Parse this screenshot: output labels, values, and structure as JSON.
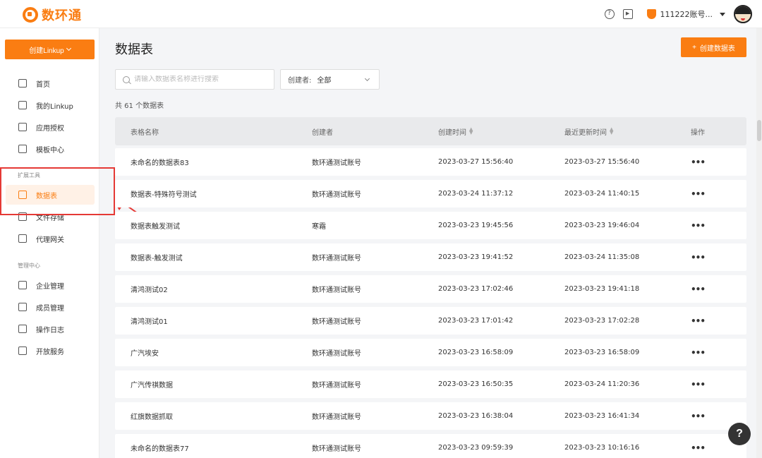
{
  "brand": {
    "name": "数环通",
    "color": "#fa7d12"
  },
  "header": {
    "help_icon": "question-circle-icon",
    "video_icon": "play-square-icon",
    "account_name": "111222账号...",
    "account_icon": "shield-icon"
  },
  "sidebar": {
    "create_button_label": "创建Linkup",
    "items_main": [
      {
        "label": "首页",
        "icon": "home-icon"
      },
      {
        "label": "我的Linkup",
        "icon": "layers-icon"
      },
      {
        "label": "应用授权",
        "icon": "cube-icon"
      },
      {
        "label": "模板中心",
        "icon": "grid-icon"
      }
    ],
    "section_tools": "扩展工具",
    "items_tools": [
      {
        "label": "数据表",
        "icon": "table-icon",
        "active": true
      },
      {
        "label": "文件存储",
        "icon": "folder-icon"
      },
      {
        "label": "代理网关",
        "icon": "gateway-icon"
      }
    ],
    "section_admin": "管理中心",
    "items_admin": [
      {
        "label": "企业管理",
        "icon": "building-icon"
      },
      {
        "label": "成员管理",
        "icon": "users-icon"
      },
      {
        "label": "操作日志",
        "icon": "clipboard-icon"
      },
      {
        "label": "开放服务",
        "icon": "share-icon"
      }
    ]
  },
  "main": {
    "title": "数据表",
    "create_button_label": "创建数据表",
    "search_placeholder": "请输入数据表名称进行搜索",
    "filter_label": "创建者:",
    "filter_value": "全部",
    "count_text": "共 61 个数据表",
    "columns": {
      "name": "表格名称",
      "creator": "创建者",
      "created": "创建时间",
      "updated": "最近更新时间",
      "actions": "操作"
    },
    "rows": [
      {
        "name": "未命名的数据表83",
        "creator": "数环通测试账号",
        "created": "2023-03-27 15:56:40",
        "updated": "2023-03-27 15:56:40",
        "actions": "•••"
      },
      {
        "name": "数据表-特殊符号测试",
        "creator": "数环通测试账号",
        "created": "2023-03-24 11:37:12",
        "updated": "2023-03-24 11:40:15",
        "actions": "•••"
      },
      {
        "name": "数据表触发测试",
        "creator": "寒霜",
        "created": "2023-03-23 19:45:56",
        "updated": "2023-03-23 19:46:04",
        "actions": "•••"
      },
      {
        "name": "数据表-触发测试",
        "creator": "数环通测试账号",
        "created": "2023-03-23 19:41:52",
        "updated": "2023-03-24 11:35:08",
        "actions": "•••"
      },
      {
        "name": "清鸿测试02",
        "creator": "数环通测试账号",
        "created": "2023-03-23 17:02:46",
        "updated": "2023-03-23 19:41:18",
        "actions": "•••"
      },
      {
        "name": "清鸿测试01",
        "creator": "数环通测试账号",
        "created": "2023-03-23 17:01:42",
        "updated": "2023-03-23 17:02:28",
        "actions": "•••"
      },
      {
        "name": "广汽埃安",
        "creator": "数环通测试账号",
        "created": "2023-03-23 16:58:09",
        "updated": "2023-03-23 16:58:09",
        "actions": "•••"
      },
      {
        "name": "广汽传祺数据",
        "creator": "数环通测试账号",
        "created": "2023-03-23 16:50:35",
        "updated": "2023-03-24 11:20:36",
        "actions": "•••"
      },
      {
        "name": "红旗数据抓取",
        "creator": "数环通测试账号",
        "created": "2023-03-23 16:38:04",
        "updated": "2023-03-23 16:41:34",
        "actions": "•••"
      },
      {
        "name": "未命名的数据表77",
        "creator": "数环通测试账号",
        "created": "2023-03-23 09:59:39",
        "updated": "2023-03-23 10:16:16",
        "actions": "•••"
      }
    ]
  },
  "help_fab": {
    "label": "?",
    "icon": "help-icon"
  }
}
